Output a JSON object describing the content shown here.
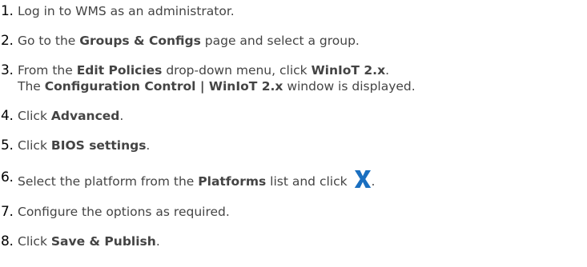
{
  "steps": [
    {
      "number": "1.",
      "parts": [
        {
          "text": "Log in to WMS as an administrator.",
          "bold": false
        }
      ]
    },
    {
      "number": "2.",
      "parts": [
        {
          "text": "Go to the ",
          "bold": false
        },
        {
          "text": "Groups & Configs",
          "bold": true
        },
        {
          "text": " page and select a group.",
          "bold": false
        }
      ]
    },
    {
      "number": "3.",
      "parts": [
        {
          "text": "From the ",
          "bold": false
        },
        {
          "text": "Edit Policies",
          "bold": true
        },
        {
          "text": " drop-down menu, click ",
          "bold": false
        },
        {
          "text": "WinIoT 2.x",
          "bold": true
        },
        {
          "text": ".",
          "bold": false
        }
      ],
      "parts_line2": [
        {
          "text": "The ",
          "bold": false
        },
        {
          "text": "Configuration Control | WinIoT 2.x",
          "bold": true
        },
        {
          "text": " window is displayed.",
          "bold": false
        }
      ]
    },
    {
      "number": "4.",
      "parts": [
        {
          "text": "Click ",
          "bold": false
        },
        {
          "text": "Advanced",
          "bold": true
        },
        {
          "text": ".",
          "bold": false
        }
      ]
    },
    {
      "number": "5.",
      "parts": [
        {
          "text": "Click ",
          "bold": false
        },
        {
          "text": "BIOS settings",
          "bold": true
        },
        {
          "text": ".",
          "bold": false
        }
      ]
    },
    {
      "number": "6.",
      "parts": [
        {
          "text": "Select the platform from the ",
          "bold": false
        },
        {
          "text": "Platforms",
          "bold": true
        },
        {
          "text": " list and click ",
          "bold": false
        },
        {
          "icon": "x-icon"
        },
        {
          "text": ".",
          "bold": false
        }
      ]
    },
    {
      "number": "7.",
      "parts": [
        {
          "text": "Configure the options as required.",
          "bold": false
        }
      ]
    },
    {
      "number": "8.",
      "parts": [
        {
          "text": "Click ",
          "bold": false
        },
        {
          "text": "Save & Publish",
          "bold": true
        },
        {
          "text": ".",
          "bold": false
        }
      ]
    }
  ],
  "colors": {
    "text": "#444444",
    "number": "#000000",
    "icon": "#1a6fc0"
  }
}
